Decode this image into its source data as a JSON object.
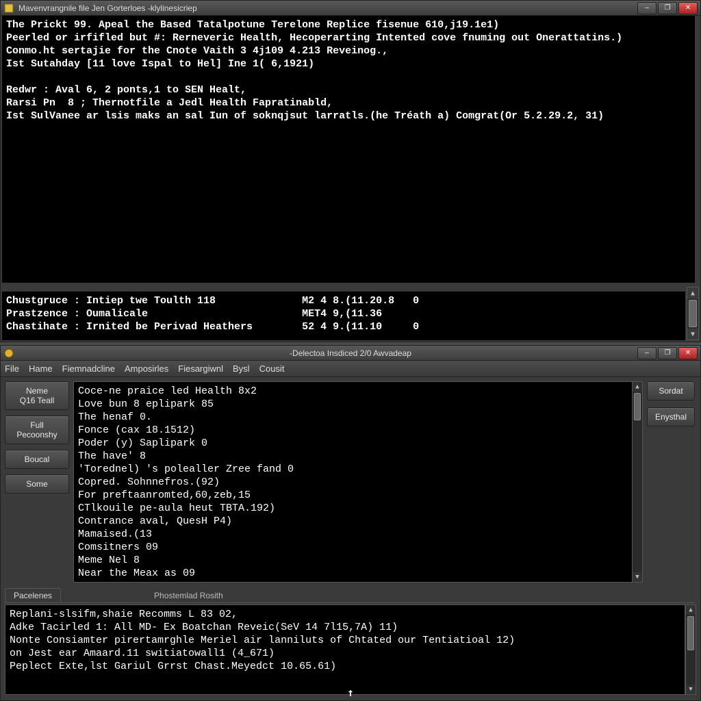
{
  "top_window": {
    "title": "Mavenvrangnile file Jen Gorterloes -klylinesicriep",
    "icon": "app-icon-yellow",
    "main_lines": [
      "The Prickt 99. Apeal the Based Tatalpotune Terelone Replice fisenue 610,j19.1e1)",
      "Peerled or irfifled but #: Rerneveric Health, Hecoperarting Intented cove fnuming out Onerattatins.)",
      "Conmo.ht sertajie for the Cnote Vaith 3 4j109 4.213 Reveinog.,",
      "Ist Sutahday [11 love Ispal to Hel] Ine 1( 6,1921)",
      "",
      "Redwr : Aval 6, 2 ponts,1 to SEN Healt,",
      "Rarsi Pn  8 ; Thernotfile a Jedl Health Fapratinabld,",
      "Ist SulVanee ar lsis maks an sal Iun of soknqjsut larratls.(he Tréath a) Comgrat(Or 5.2.29.2, 31)"
    ],
    "status_rows": [
      {
        "label": "Chustgruce : Intiep twe Toulth 118",
        "mid": "M2 4 8.(11.20.8",
        "tail": "0"
      },
      {
        "label": "Prastzence : Oumalicale",
        "mid": "MET4 9,(11.36",
        "tail": ""
      },
      {
        "label": "Chastihate : Irnited be Perivad Heathers",
        "mid": "52 4 9.(11.10",
        "tail": "0"
      }
    ]
  },
  "bottom_window": {
    "title": "-Delectoa Insdiced 2/0 Awvadeap",
    "icon": "app-icon-gold",
    "menu": [
      "File",
      "Hame",
      "Fiemnadcline",
      "Amposirles",
      "Fiesargiwnl",
      "Bysl",
      "Cousit"
    ],
    "left_buttons": [
      [
        "Neme",
        "Q16 Teall"
      ],
      [
        "Full",
        "Pecoonshy"
      ],
      [
        "Boucal"
      ],
      [
        "Some"
      ]
    ],
    "right_buttons": [
      "Sordat",
      "Enysthal"
    ],
    "term_lines": [
      "Coce-ne praice led Health 8x2",
      "Love bun 8 eplipark 85",
      "The henaf 0.",
      "Fonce (cax 18.1512)",
      "Poder (y) Saplipark 0",
      "The have' 8",
      "'Torednel) 's polealler Zree fand 0",
      "Copred. Sohnnefros.(92)",
      "For preftaanromted,60,zeb,15",
      "CTlkouile pe-aula heut TBTA.192)",
      "Contrance aval, QuesH P4)",
      "Mamaised.(13",
      "Comsitners 09",
      "Meme Nel 8",
      "Near the Meax as 09"
    ],
    "tabs": {
      "primary": "Pacelenes",
      "secondary": "Phostemlad Rosith"
    },
    "lower_lines": [
      "Replani-slsifm,shaie Recomms L 83 02,",
      "Adke Tacirled 1: All MD- Ex Boatchan Reveic(SeV 14 7l15,7A) 11)",
      "Nonte Consiamter pirertamrghle Meriel air lanniluts of Chtated our Tentiatioal 12)",
      "on Jest ear Amaard.11 switiatowall1 (4_671)",
      "Peplect Exte,lst Gariul Grrst Chast.Meyedct 10.65.61)"
    ]
  },
  "win_controls": {
    "min": "–",
    "max": "❐",
    "close": "✕"
  }
}
